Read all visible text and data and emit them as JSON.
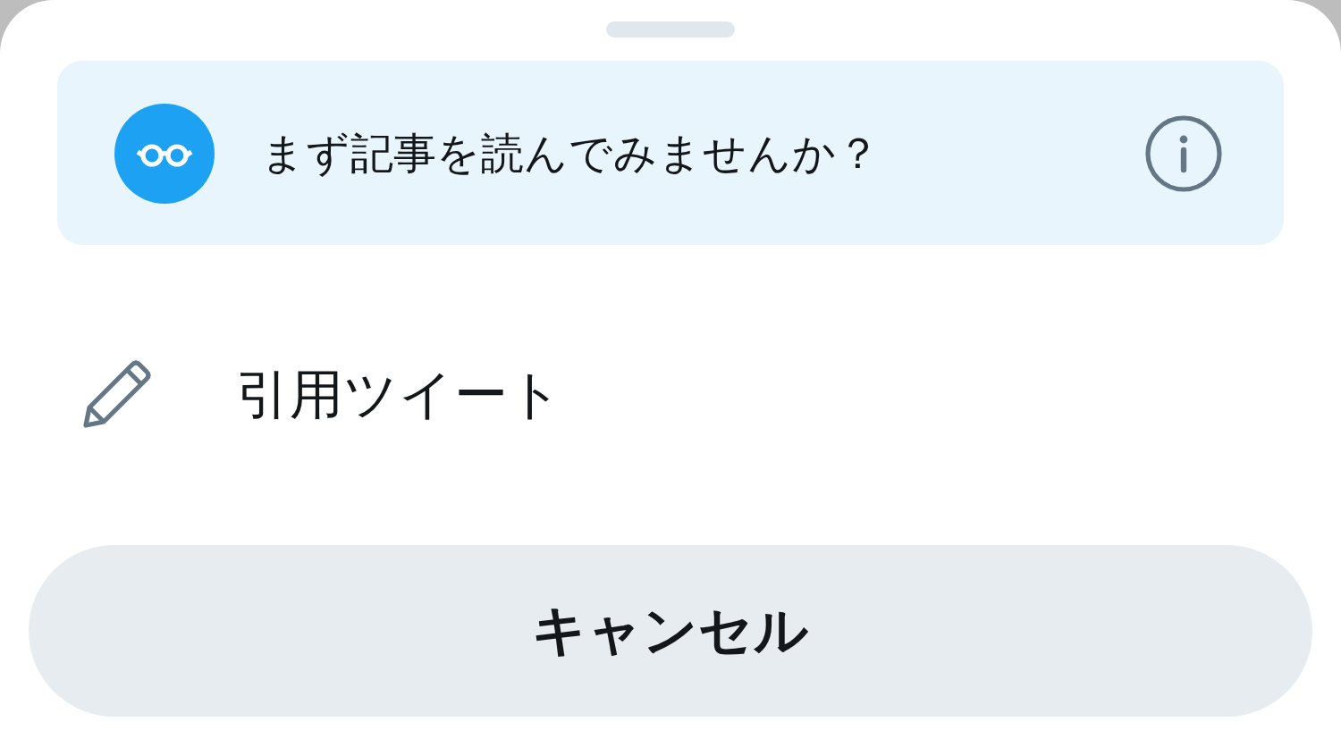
{
  "banner": {
    "text": "まず記事を読んでみませんか？"
  },
  "actions": [
    {
      "label": "引用ツイート"
    }
  ],
  "cancel_button": {
    "label": "キャンセル"
  }
}
